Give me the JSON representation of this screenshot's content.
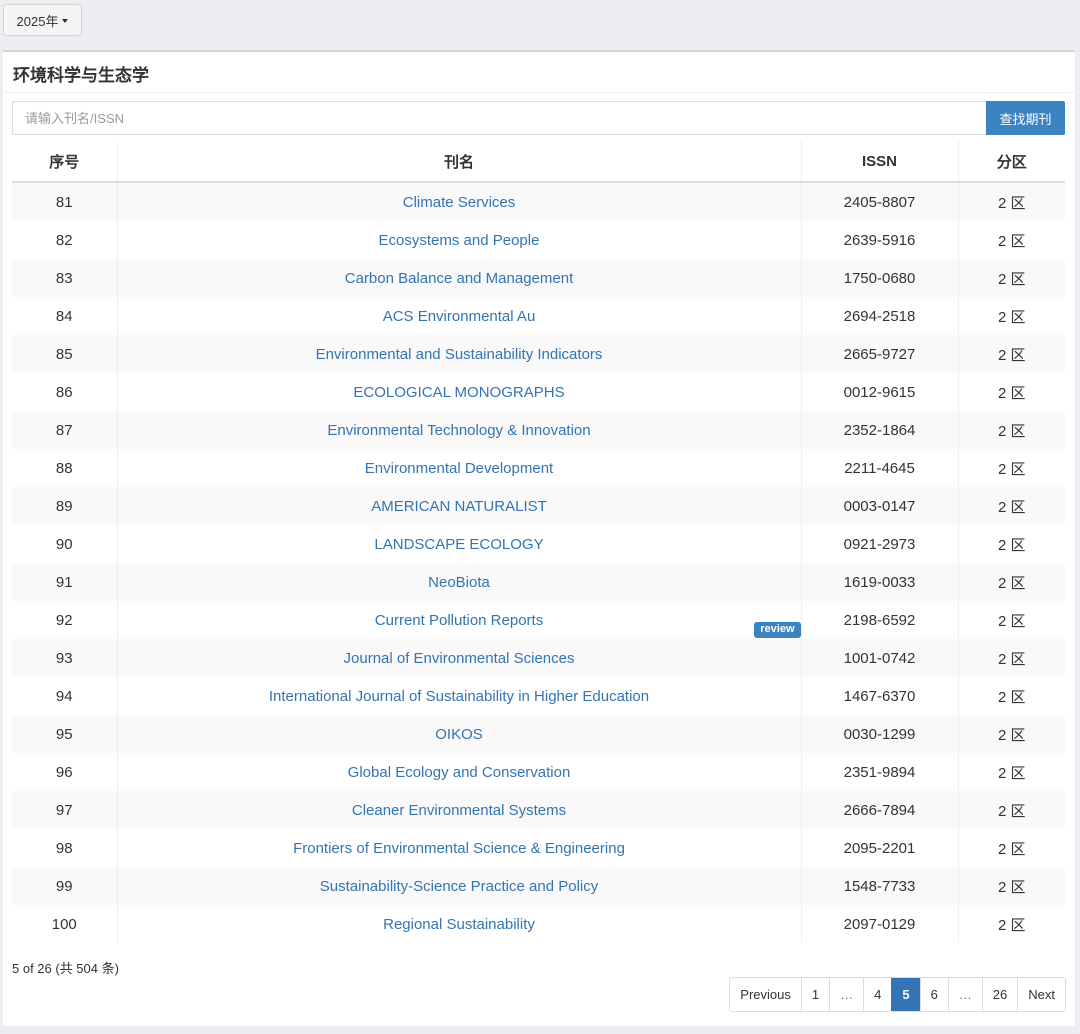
{
  "year_selector": {
    "label": "2025年"
  },
  "panel": {
    "title": "环境科学与生态学"
  },
  "search": {
    "placeholder": "请输入刊名/ISSN",
    "button_label": "查找期刊"
  },
  "table": {
    "headers": {
      "index": "序号",
      "name": "刊名",
      "issn": "ISSN",
      "zone": "分区"
    },
    "rows": [
      {
        "index": "81",
        "name": "Climate Services",
        "issn": "2405-8807",
        "zone": "2 区"
      },
      {
        "index": "82",
        "name": "Ecosystems and People",
        "issn": "2639-5916",
        "zone": "2 区"
      },
      {
        "index": "83",
        "name": "Carbon Balance and Management",
        "issn": "1750-0680",
        "zone": "2 区"
      },
      {
        "index": "84",
        "name": "ACS Environmental Au",
        "issn": "2694-2518",
        "zone": "2 区"
      },
      {
        "index": "85",
        "name": "Environmental and Sustainability Indicators",
        "issn": "2665-9727",
        "zone": "2 区"
      },
      {
        "index": "86",
        "name": "ECOLOGICAL MONOGRAPHS",
        "issn": "0012-9615",
        "zone": "2 区"
      },
      {
        "index": "87",
        "name": "Environmental Technology & Innovation",
        "issn": "2352-1864",
        "zone": "2 区"
      },
      {
        "index": "88",
        "name": "Environmental Development",
        "issn": "2211-4645",
        "zone": "2 区"
      },
      {
        "index": "89",
        "name": "AMERICAN NATURALIST",
        "issn": "0003-0147",
        "zone": "2 区"
      },
      {
        "index": "90",
        "name": "LANDSCAPE ECOLOGY",
        "issn": "0921-2973",
        "zone": "2 区"
      },
      {
        "index": "91",
        "name": "NeoBiota",
        "issn": "1619-0033",
        "zone": "2 区"
      },
      {
        "index": "92",
        "name": "Current Pollution Reports",
        "issn": "2198-6592",
        "zone": "2 区",
        "badge": "review"
      },
      {
        "index": "93",
        "name": "Journal of Environmental Sciences",
        "issn": "1001-0742",
        "zone": "2 区"
      },
      {
        "index": "94",
        "name": "International Journal of Sustainability in Higher Education",
        "issn": "1467-6370",
        "zone": "2 区"
      },
      {
        "index": "95",
        "name": "OIKOS",
        "issn": "0030-1299",
        "zone": "2 区"
      },
      {
        "index": "96",
        "name": "Global Ecology and Conservation",
        "issn": "2351-9894",
        "zone": "2 区"
      },
      {
        "index": "97",
        "name": "Cleaner Environmental Systems",
        "issn": "2666-7894",
        "zone": "2 区"
      },
      {
        "index": "98",
        "name": "Frontiers of Environmental Science & Engineering",
        "issn": "2095-2201",
        "zone": "2 区"
      },
      {
        "index": "99",
        "name": "Sustainability-Science Practice and Policy",
        "issn": "1548-7733",
        "zone": "2 区"
      },
      {
        "index": "100",
        "name": "Regional Sustainability",
        "issn": "2097-0129",
        "zone": "2 区"
      }
    ]
  },
  "footer": {
    "info": "5 of 26 (共 504 条)"
  },
  "pagination": {
    "previous": "Previous",
    "next": "Next",
    "pages": [
      "1",
      "…",
      "4",
      "5",
      "6",
      "…",
      "26"
    ],
    "current": "5"
  },
  "colors": {
    "accent": "#3c83c2",
    "link": "#3374b4",
    "background": "#eceef1"
  }
}
